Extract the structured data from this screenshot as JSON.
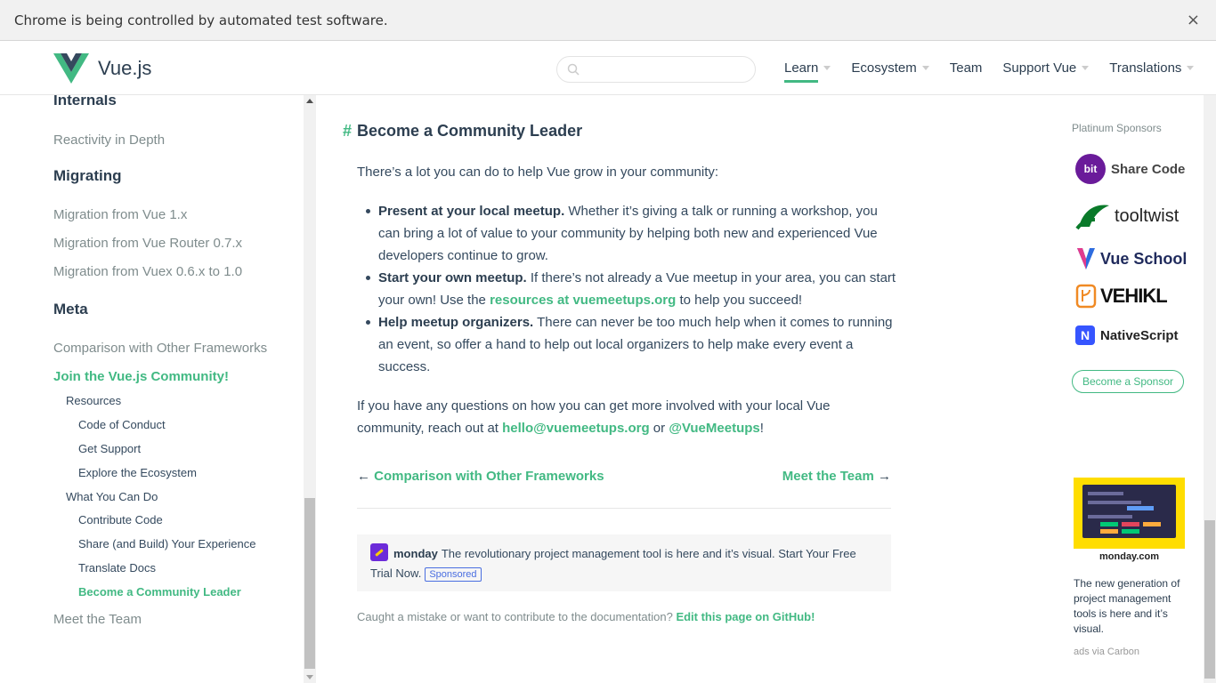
{
  "infobar": {
    "text": "Chrome is being controlled by automated test software.",
    "close": "×"
  },
  "header": {
    "logo_text": "Vue.js",
    "search_placeholder": "",
    "nav": [
      {
        "label": "Learn",
        "active": true
      },
      {
        "label": "Ecosystem"
      },
      {
        "label": "Team"
      },
      {
        "label": "Support Vue"
      },
      {
        "label": "Translations"
      }
    ]
  },
  "sidebar": {
    "internals": "Internals",
    "reactivity": "Reactivity in Depth",
    "migrating": "Migrating",
    "migration_vue1": "Migration from Vue 1.x",
    "migration_router": "Migration from Vue Router 0.7.x",
    "migration_vuex": "Migration from Vuex 0.6.x to 1.0",
    "meta": "Meta",
    "comparison": "Comparison with Other Frameworks",
    "join": "Join the Vue.js Community!",
    "resources": "Resources",
    "code_of_conduct": "Code of Conduct",
    "get_support": "Get Support",
    "explore": "Explore the Ecosystem",
    "what_you_can_do": "What You Can Do",
    "contribute_code": "Contribute Code",
    "share_build": "Share (and Build) Your Experience",
    "translate_docs": "Translate Docs",
    "become_leader": "Become a Community Leader",
    "meet_team": "Meet the Team"
  },
  "content": {
    "heading_hash": "#",
    "heading": "Become a Community Leader",
    "intro": "There’s a lot you can do to help Vue grow in your community:",
    "bullets": [
      {
        "bold": "Present at your local meetup.",
        "text": " Whether it’s giving a talk or running a workshop, you can bring a lot of value to your community by helping both new and experienced Vue developers continue to grow."
      },
      {
        "bold": "Start your own meetup.",
        "text_before": " If there’s not already a Vue meetup in your area, you can start your own! Use the ",
        "link": "resources at vuemeetups.org",
        "text_after": " to help you succeed!"
      },
      {
        "bold": "Help meetup organizers.",
        "text": " There can never be too much help when it comes to running an event, so offer a hand to help out local organizers to help make every event a success."
      }
    ],
    "question_before": "If you have any questions on how you can get more involved with your local Vue community, reach out at ",
    "question_email": "hello@vuemeetups.org",
    "question_or": " or ",
    "question_twitter": "@VueMeetups",
    "question_end": "!",
    "prev_arrow": "←",
    "prev_label": "Comparison with Other Frameworks",
    "next_label": "Meet the Team",
    "next_arrow": "→",
    "ad": {
      "name": "monday",
      "text": "The revolutionary project management tool is here and it’s visual. Start Your Free Trial Now.",
      "badge": "Sponsored"
    },
    "footer_text": "Caught a mistake or want to contribute to the documentation? ",
    "footer_link": "Edit this page on GitHub!"
  },
  "right": {
    "platinum_title": "Platinum Sponsors",
    "sponsors": {
      "bit_logo": "bit",
      "bit": "Share Code",
      "tooltwist": "tooltwist",
      "vueschool": "Vue School",
      "vehikl": "VEHIKL",
      "nativescript_logo": "N",
      "nativescript": "NativeScript"
    },
    "become_sponsor": "Become a Sponsor",
    "carbon_brand": "monday.com",
    "carbon_text": "The new generation of project management tools is here and it’s visual.",
    "carbon_via": "ads via Carbon"
  },
  "colors": {
    "accent": "#42b983",
    "text": "#2c3e50",
    "muted": "#7f8c8d"
  }
}
